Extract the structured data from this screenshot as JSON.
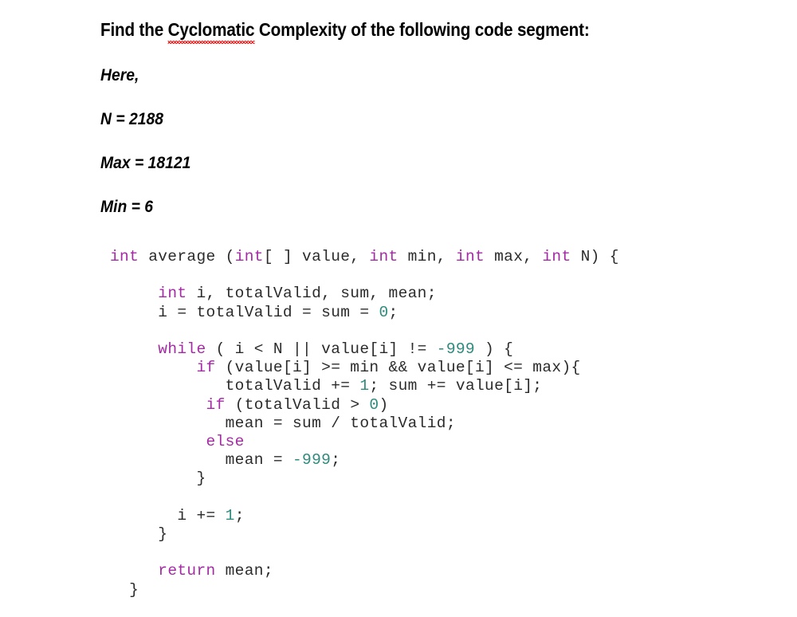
{
  "slide": {
    "prompt": {
      "before": "Find the ",
      "misspelled_word": "Cyclomatic",
      "after": " Complexity of the following code segment:",
      "spellcheck_color": "#ff0000"
    },
    "givens": [
      {
        "text": "Here,"
      },
      {
        "text": "N = 2188"
      },
      {
        "text": "Max = 18121"
      },
      {
        "text": "Min = 6"
      }
    ],
    "code": {
      "language": "java",
      "keyword_color": "#a42ba4",
      "number_color": "#2e8b7d",
      "text_color": "#2b2b2b",
      "background_color": "#ffffff",
      "lines": [
        {
          "id": "l01",
          "tokens": [
            {
              "t": "kw",
              "v": "int"
            },
            {
              "t": "plain",
              "v": " average ("
            },
            {
              "t": "kw",
              "v": "int"
            },
            {
              "t": "plain",
              "v": "[ ] value, "
            },
            {
              "t": "kw",
              "v": "int"
            },
            {
              "t": "plain",
              "v": " min, "
            },
            {
              "t": "kw",
              "v": "int"
            },
            {
              "t": "plain",
              "v": " max, "
            },
            {
              "t": "kw",
              "v": "int"
            },
            {
              "t": "plain",
              "v": " N) {"
            }
          ]
        },
        {
          "id": "l02",
          "blank": true,
          "tokens": []
        },
        {
          "id": "l03",
          "tokens": [
            {
              "t": "plain",
              "v": "     "
            },
            {
              "t": "kw",
              "v": "int"
            },
            {
              "t": "plain",
              "v": " i, totalValid, sum, mean;"
            }
          ]
        },
        {
          "id": "l04",
          "tokens": [
            {
              "t": "plain",
              "v": "     i = totalValid = sum = "
            },
            {
              "t": "num",
              "v": "0"
            },
            {
              "t": "plain",
              "v": ";"
            }
          ]
        },
        {
          "id": "l05",
          "blank": true,
          "tokens": []
        },
        {
          "id": "l06",
          "tokens": [
            {
              "t": "plain",
              "v": "     "
            },
            {
              "t": "kw",
              "v": "while"
            },
            {
              "t": "plain",
              "v": " ( i < N || value[i] != "
            },
            {
              "t": "num",
              "v": "-999"
            },
            {
              "t": "plain",
              "v": " ) {"
            }
          ]
        },
        {
          "id": "l07",
          "tokens": [
            {
              "t": "plain",
              "v": "         "
            },
            {
              "t": "kw",
              "v": "if"
            },
            {
              "t": "plain",
              "v": " (value[i] >= min && value[i] <= max){"
            }
          ]
        },
        {
          "id": "l08",
          "tokens": [
            {
              "t": "plain",
              "v": "            totalValid += "
            },
            {
              "t": "num",
              "v": "1"
            },
            {
              "t": "plain",
              "v": "; sum += value[i];"
            }
          ]
        },
        {
          "id": "l09",
          "tokens": [
            {
              "t": "plain",
              "v": "          "
            },
            {
              "t": "kw",
              "v": "if"
            },
            {
              "t": "plain",
              "v": " (totalValid > "
            },
            {
              "t": "num",
              "v": "0"
            },
            {
              "t": "plain",
              "v": ")"
            }
          ]
        },
        {
          "id": "l10",
          "tokens": [
            {
              "t": "plain",
              "v": "            mean = sum / totalValid;"
            }
          ]
        },
        {
          "id": "l11",
          "tokens": [
            {
              "t": "plain",
              "v": "          "
            },
            {
              "t": "kw",
              "v": "else"
            }
          ]
        },
        {
          "id": "l12",
          "tokens": [
            {
              "t": "plain",
              "v": "            mean = "
            },
            {
              "t": "num",
              "v": "-999"
            },
            {
              "t": "plain",
              "v": ";"
            }
          ]
        },
        {
          "id": "l13",
          "tokens": [
            {
              "t": "plain",
              "v": "         }"
            }
          ]
        },
        {
          "id": "l14",
          "blank": true,
          "tokens": []
        },
        {
          "id": "l15",
          "tokens": [
            {
              "t": "plain",
              "v": "       i += "
            },
            {
              "t": "num",
              "v": "1"
            },
            {
              "t": "plain",
              "v": ";"
            }
          ]
        },
        {
          "id": "l16",
          "tokens": [
            {
              "t": "plain",
              "v": "     }"
            }
          ]
        },
        {
          "id": "l17",
          "blank": true,
          "tokens": []
        },
        {
          "id": "l18",
          "tokens": [
            {
              "t": "plain",
              "v": "     "
            },
            {
              "t": "kw",
              "v": "return"
            },
            {
              "t": "plain",
              "v": " mean;"
            }
          ]
        },
        {
          "id": "l19",
          "tokens": [
            {
              "t": "plain",
              "v": "  }"
            }
          ]
        }
      ]
    }
  }
}
